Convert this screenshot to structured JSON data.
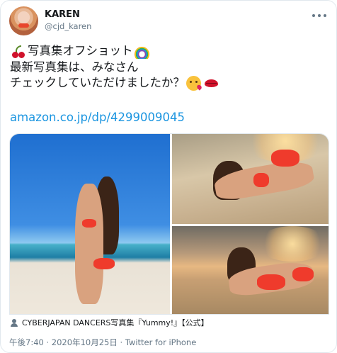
{
  "author": {
    "display_name": "KAREN",
    "handle": "@cjd_karen",
    "avatar_icon": "profile-photo"
  },
  "tweet": {
    "line1": "写真集オフショット",
    "line2": "最新写真集は、みなさん",
    "line3": "チェックしていただけましたか？",
    "link": "amazon.co.jp/dp/4299009045",
    "emojis": [
      "cherry-emoji",
      "rainbow-emoji",
      "kissing-face-emoji",
      "lips-emoji"
    ]
  },
  "media": {
    "photo_count": 3,
    "attribution": "CYBERJAPAN DANCERS写真集『Yummy!』【公式】"
  },
  "meta": {
    "time": "午後7:40",
    "separator": "·",
    "date": "2020年10月25日",
    "source": "Twitter for iPhone"
  },
  "colors": {
    "link": "#1b95e0",
    "text": "#14171a",
    "secondary": "#657786",
    "border": "#e1e8ed"
  }
}
